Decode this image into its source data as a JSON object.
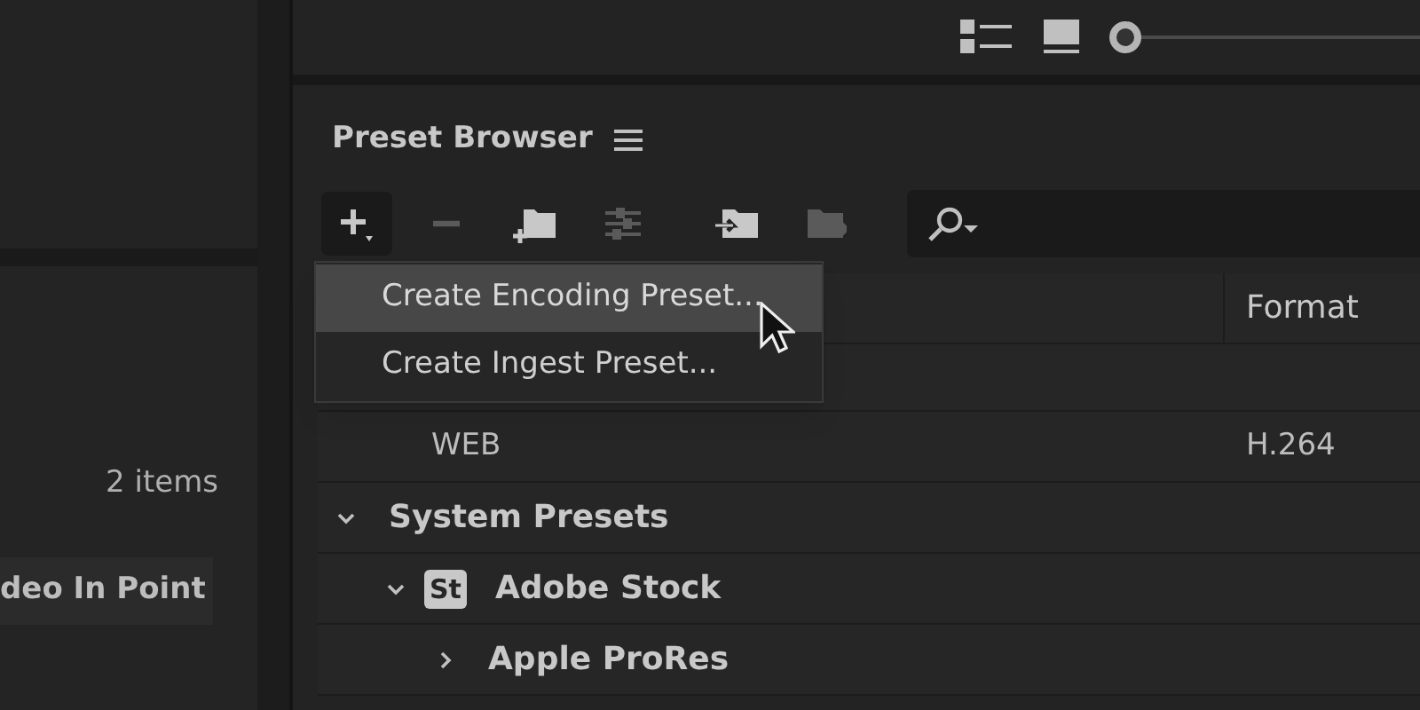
{
  "left_panel": {
    "item_count": "2 items",
    "column_header": "deo In Point"
  },
  "top_toolbar": {
    "zoom_slider": {
      "level": 0
    }
  },
  "preset_browser": {
    "title": "Preset Browser",
    "toolbar": [
      {
        "kind": "add",
        "disabled": false
      },
      {
        "kind": "remove",
        "disabled": true
      },
      {
        "kind": "new-group",
        "disabled": false
      },
      {
        "kind": "settings",
        "disabled": true
      },
      {
        "kind": "import",
        "disabled": false
      },
      {
        "kind": "export",
        "disabled": true
      }
    ],
    "menu": {
      "items": [
        {
          "label": "Create Encoding Preset...",
          "selected": true
        },
        {
          "label": "Create Ingest Preset...",
          "selected": false
        }
      ]
    },
    "columns": [
      {
        "label": "Format"
      }
    ],
    "rows": [
      {
        "label": "WEB",
        "format": "H.264"
      }
    ],
    "tree": [
      {
        "label": "System Presets",
        "expanded": true,
        "children": [
          {
            "label": "Adobe Stock",
            "badge": "St",
            "expanded": true,
            "children": [
              {
                "label": "Apple ProRes",
                "expanded": false
              }
            ]
          }
        ]
      }
    ]
  }
}
